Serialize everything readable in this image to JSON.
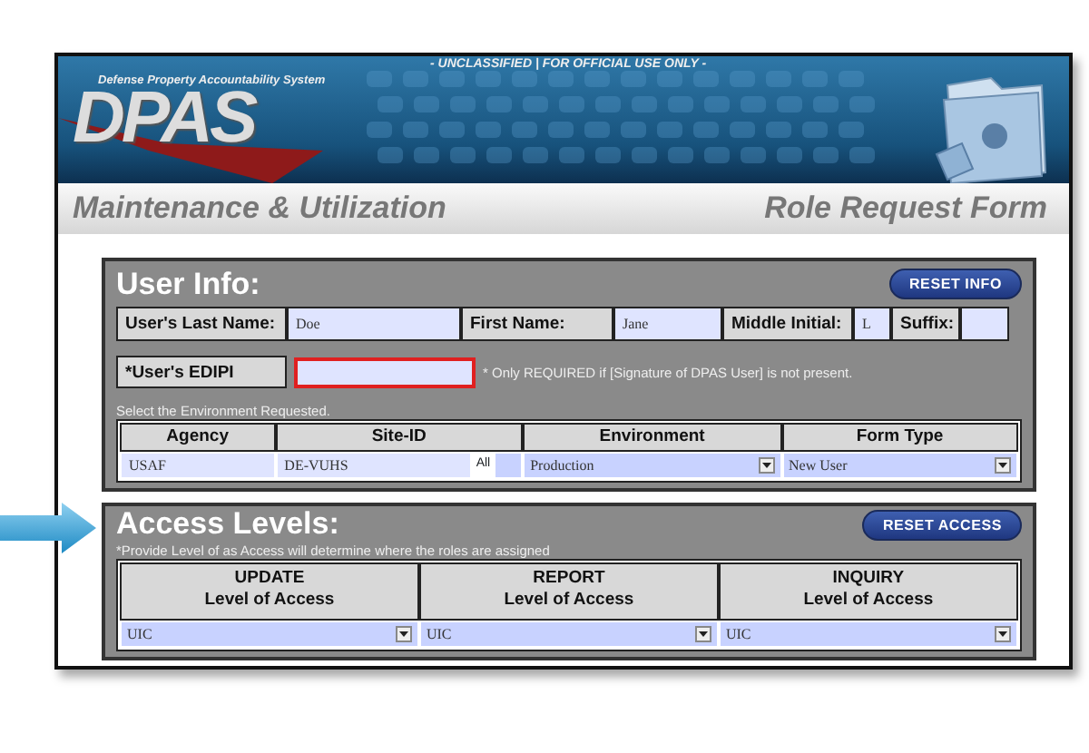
{
  "header": {
    "system_name": "Defense Property Accountability System",
    "logo": "DPAS",
    "classification": "- UNCLASSIFIED | FOR OFFICIAL USE ONLY -",
    "module_title": "Maintenance & Utilization",
    "form_title": "Role Request Form"
  },
  "user_info": {
    "title": "User Info:",
    "reset_button": "RESET INFO",
    "name_fields": [
      {
        "label": "User's Last Name:",
        "value": "Doe"
      },
      {
        "label": "First Name:",
        "value": "Jane"
      },
      {
        "label": "Middle Initial:",
        "value": "L"
      },
      {
        "label": "Suffix:"
      }
    ],
    "edipi": {
      "label": "*User's EDIPI",
      "invalid": true,
      "note": "* Only REQUIRED if [Signature of DPAS User] is not present."
    },
    "environment_caption": "Select the Environment Requested.",
    "columns": [
      "Agency",
      "Site-ID",
      "Environment",
      "Form Type"
    ],
    "agency": "USAF",
    "site_id": "DE-VUHS",
    "site_scope": "All",
    "site_scope_checked": false,
    "environment": "Production",
    "form_type": "New User"
  },
  "access_levels": {
    "title": "Access Levels:",
    "reset_button": "RESET ACCESS",
    "caption": "*Provide Level of as Access will determine where the roles are assigned",
    "columns": [
      {
        "name": "UPDATE",
        "subtitle": "Level of Access",
        "value": "UIC"
      },
      {
        "name": "REPORT",
        "subtitle": "Level of Access",
        "value": "UIC"
      },
      {
        "name": "INQUIRY",
        "subtitle": "Level of Access",
        "value": "UIC"
      }
    ]
  }
}
